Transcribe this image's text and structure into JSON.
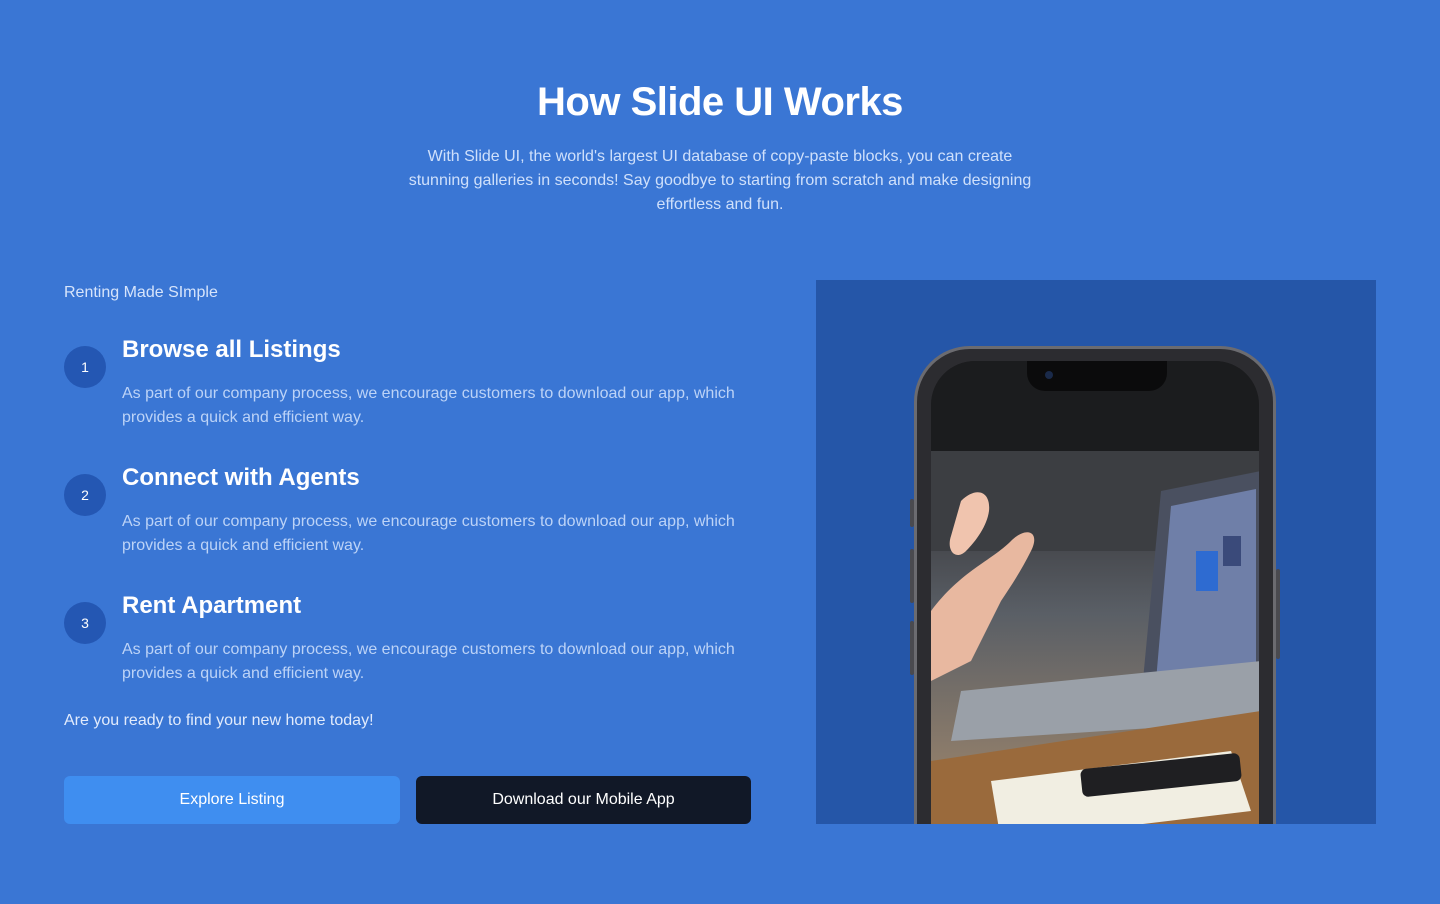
{
  "hero": {
    "title": "How Slide UI Works",
    "subtitle": "With Slide UI, the world's largest UI database of copy-paste blocks, you can create stunning galleries in seconds! Say goodbye to starting from scratch and make designing effortless and fun."
  },
  "section": {
    "eyebrow": "Renting Made SImple",
    "steps": [
      {
        "number": "1",
        "title": "Browse all Listings",
        "description": "As part of our company process, we encourage customers to download our app, which provides a quick and efficient way."
      },
      {
        "number": "2",
        "title": "Connect with Agents",
        "description": "As part of our company process, we encourage customers to download our app, which provides a quick and efficient way."
      },
      {
        "number": "3",
        "title": "Rent Apartment",
        "description": "As part of our company process, we encourage customers to download our app, which provides a quick and efficient way."
      }
    ],
    "cta_text": "Are you ready to find your new home today!",
    "buttons": {
      "explore_label": "Explore Listing",
      "download_label": "Download our Mobile App"
    }
  },
  "media": {
    "image_desc": "phone-mockup"
  },
  "colors": {
    "background": "#3a76d4",
    "primary_button": "#3f8ef0",
    "dark_button": "#111827",
    "step_circle": "#2457b3",
    "media_panel": "#2556a8"
  }
}
